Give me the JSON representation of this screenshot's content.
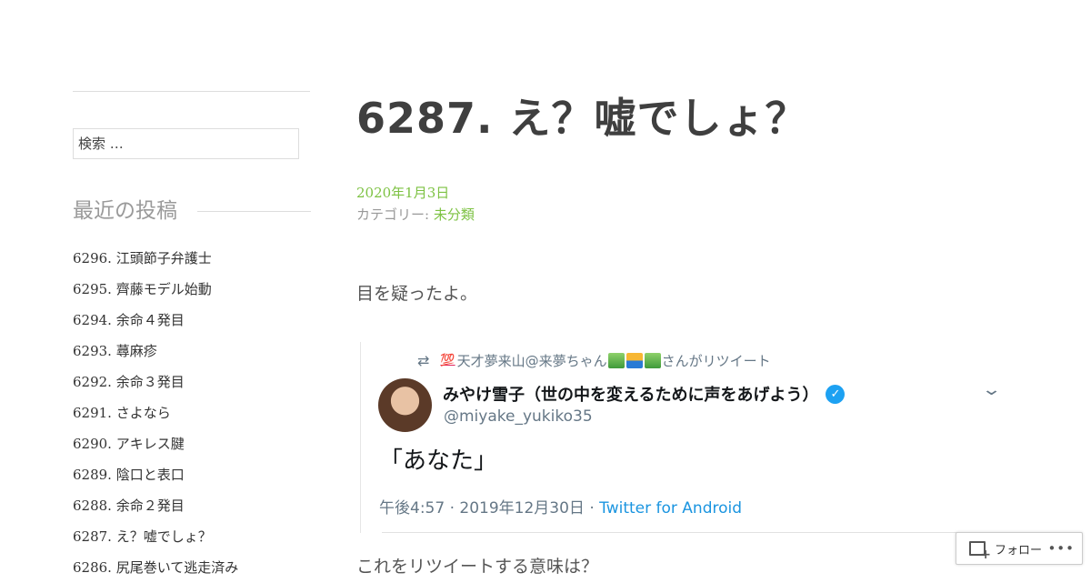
{
  "sidebar": {
    "search_placeholder": "検索 …",
    "widget_title": "最近の投稿",
    "recent_posts": [
      "6296. 江頭節子弁護士",
      "6295. 齊藤モデル始動",
      "6294. 余命４発目",
      "6293. 蕁麻疹",
      "6292. 余命３発目",
      "6291. さよなら",
      "6290. アキレス腱",
      "6289. 陰口と表口",
      "6288. 余命２発目",
      "6287. え？嘘でしょ？",
      "6286. 尻尾巻いて逃走済み"
    ]
  },
  "post": {
    "title": "6287. え？嘘でしょ？",
    "date": "2020年1月3日",
    "category_label": "カテゴリー:",
    "category": "未分類",
    "paragraph1": "目を疑ったよ。",
    "paragraph2": "これをリツイートする意味は？"
  },
  "tweet": {
    "retweet_prefix": "💯",
    "retweeter": "天才夢来山@来夢ちゃん",
    "retweet_suffix": "さんがリツイート",
    "author_name": "みやけ雪子（世の中を変えるために声をあげよう）",
    "handle": "@miyake_yukiko35",
    "text": "「あなた」",
    "timestamp": "午後4:57 · 2019年12月30日 · ",
    "client": "Twitter for Android"
  },
  "follow": {
    "label": "フォロー",
    "more": "•••"
  },
  "colors": {
    "accent_green": "#7dc243",
    "twitter_blue": "#1da1f2"
  }
}
